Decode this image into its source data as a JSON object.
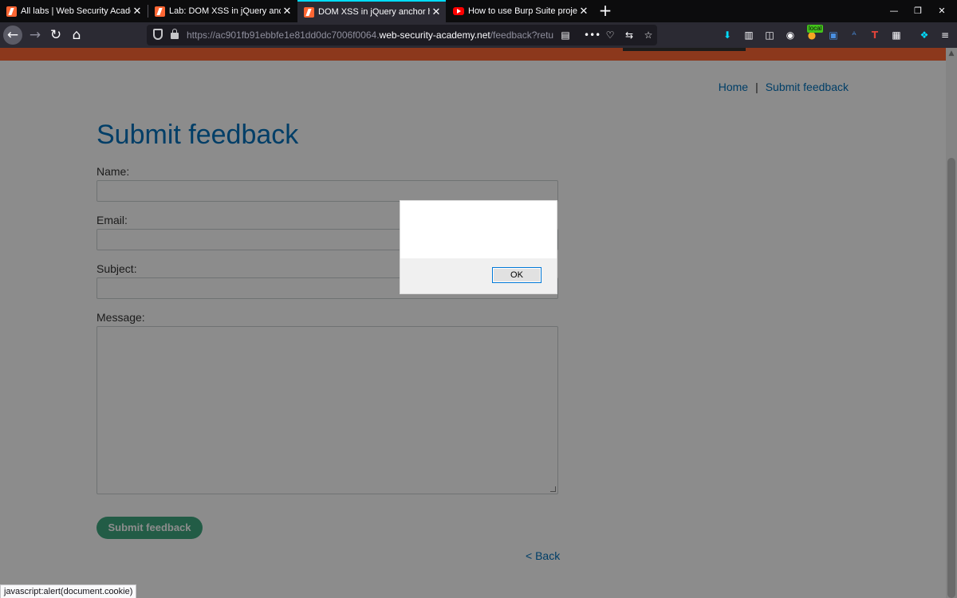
{
  "browser": {
    "tabs": [
      {
        "title": "All labs | Web Security Academy",
        "favicon": "portswigger-icon",
        "active": false
      },
      {
        "title": "Lab: DOM XSS in jQuery anchor href",
        "favicon": "portswigger-icon",
        "active": false
      },
      {
        "title": "DOM XSS in jQuery anchor href",
        "favicon": "portswigger-icon",
        "active": true
      },
      {
        "title": "How to use Burp Suite projects",
        "favicon": "youtube-icon",
        "active": false
      }
    ],
    "new_tab_label": "+",
    "window_controls": {
      "minimize": "—",
      "restore": "❐",
      "close": "✕"
    },
    "url": {
      "prefix": "https://ac901fb91ebbfe1e81dd0dc7006f0064.",
      "host": "web-security-academy.net",
      "path": "/feedback?returnPat"
    },
    "extension_badge": "local",
    "status_text": "javascript:alert(document.cookie)",
    "accent_color": "#00ddff"
  },
  "page": {
    "nav": {
      "home": "Home",
      "separator": "|",
      "feedback": "Submit feedback"
    },
    "title": "Submit feedback",
    "form": {
      "name_label": "Name:",
      "email_label": "Email:",
      "subject_label": "Subject:",
      "message_label": "Message:",
      "name_value": "",
      "email_value": "",
      "subject_value": "",
      "message_value": "",
      "submit_label": "Submit feedback"
    },
    "back_link": "< Back",
    "colors": {
      "brand_orange": "#ff6633",
      "link_blue": "#0071bc",
      "button_green": "#3fa880"
    }
  },
  "dialog": {
    "message": "",
    "ok_label": "OK"
  }
}
